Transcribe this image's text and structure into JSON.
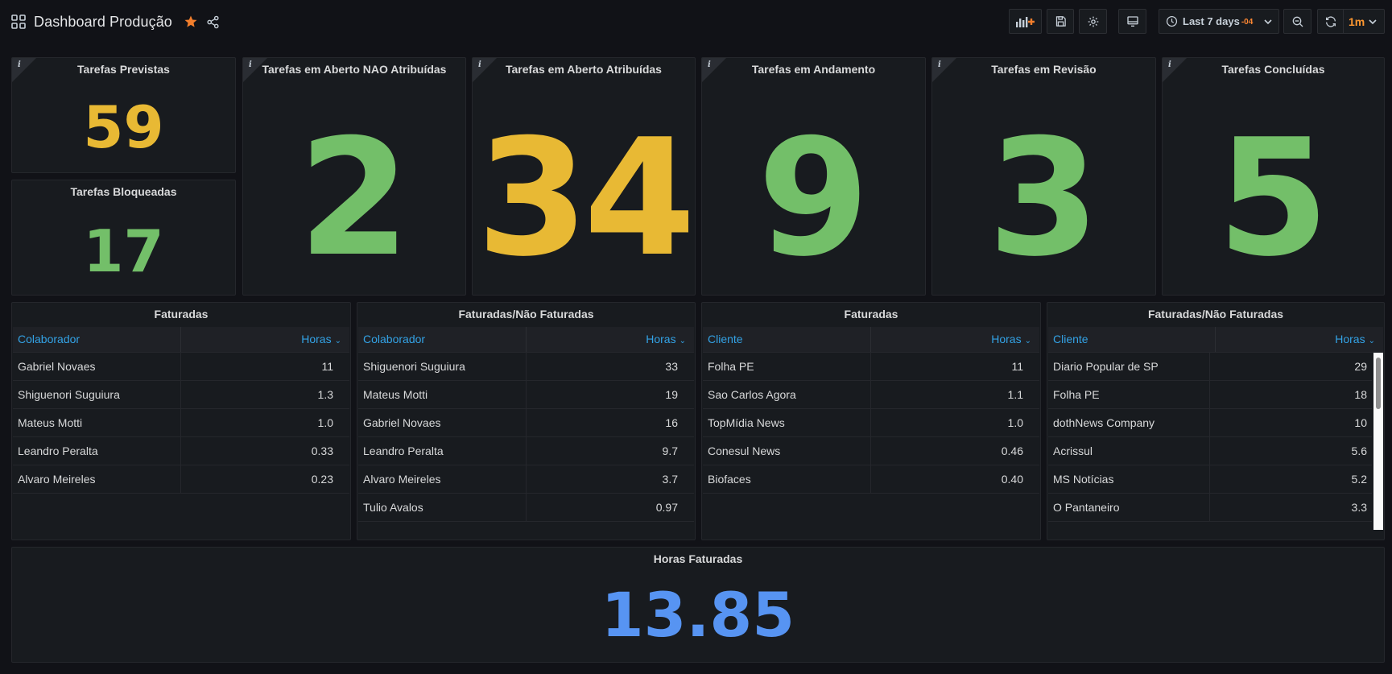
{
  "header": {
    "title": "Dashboard Produção",
    "time_range": "Last 7 days",
    "timezone": "-04",
    "refresh_interval": "1m"
  },
  "stats": {
    "previstas": {
      "title": "Tarefas Previstas",
      "value": "59",
      "color": "#e8b934"
    },
    "bloqueadas": {
      "title": "Tarefas Bloqueadas",
      "value": "17",
      "color": "#73bf69"
    },
    "aberto_nao_atribuidas": {
      "title": "Tarefas em Aberto NAO Atribuídas",
      "value": "2",
      "color": "#73bf69"
    },
    "aberto_atribuidas": {
      "title": "Tarefas em Aberto Atribuídas",
      "value": "34",
      "color": "#e8b934"
    },
    "andamento": {
      "title": "Tarefas em Andamento",
      "value": "9",
      "color": "#73bf69"
    },
    "revisao": {
      "title": "Tarefas em Revisão",
      "value": "3",
      "color": "#73bf69"
    },
    "concluidas": {
      "title": "Tarefas Concluídas",
      "value": "5",
      "color": "#73bf69"
    },
    "horas_faturadas": {
      "title": "Horas Faturadas",
      "value": "13.85",
      "color": "#5794f2"
    }
  },
  "tables": [
    {
      "title": "Faturadas",
      "col1": "Colaborador",
      "col2": "Horas",
      "rows": [
        {
          "name": "Gabriel Novaes",
          "value": "11"
        },
        {
          "name": "Shiguenori Suguiura",
          "value": "1.3"
        },
        {
          "name": "Mateus Motti",
          "value": "1.0"
        },
        {
          "name": "Leandro Peralta",
          "value": "0.33"
        },
        {
          "name": "Alvaro Meireles",
          "value": "0.23"
        }
      ]
    },
    {
      "title": "Faturadas/Não Faturadas",
      "col1": "Colaborador",
      "col2": "Horas",
      "rows": [
        {
          "name": "Shiguenori Suguiura",
          "value": "33"
        },
        {
          "name": "Mateus Motti",
          "value": "19"
        },
        {
          "name": "Gabriel Novaes",
          "value": "16"
        },
        {
          "name": "Leandro Peralta",
          "value": "9.7"
        },
        {
          "name": "Alvaro Meireles",
          "value": "3.7"
        },
        {
          "name": "Tulio Avalos",
          "value": "0.97"
        }
      ]
    },
    {
      "title": "Faturadas",
      "col1": "Cliente",
      "col2": "Horas",
      "rows": [
        {
          "name": "Folha PE",
          "value": "11"
        },
        {
          "name": "Sao Carlos Agora",
          "value": "1.1"
        },
        {
          "name": "TopMídia News",
          "value": "1.0"
        },
        {
          "name": "Conesul News",
          "value": "0.46"
        },
        {
          "name": "Biofaces",
          "value": "0.40"
        }
      ]
    },
    {
      "title": "Faturadas/Não Faturadas",
      "col1": "Cliente",
      "col2": "Horas",
      "rows": [
        {
          "name": "Diario Popular de SP",
          "value": "29"
        },
        {
          "name": "Folha PE",
          "value": "18"
        },
        {
          "name": "dothNews Company",
          "value": "10"
        },
        {
          "name": "Acrissul",
          "value": "5.6"
        },
        {
          "name": "MS Notícias",
          "value": "5.2"
        },
        {
          "name": "O Pantaneiro",
          "value": "3.3"
        }
      ]
    }
  ]
}
